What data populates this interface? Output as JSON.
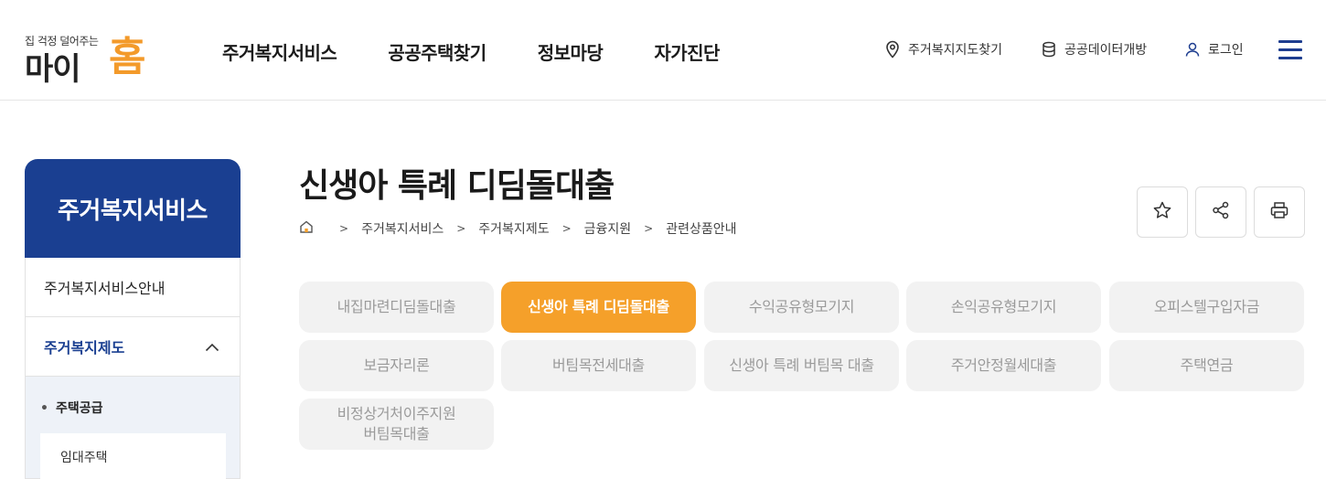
{
  "header": {
    "logo_tagline": "집 걱정 덜어주는",
    "logo_main": "마이",
    "logo_accent": "홈",
    "nav": [
      "주거복지서비스",
      "공공주택찾기",
      "정보마당",
      "자가진단"
    ],
    "util_map_label": "주거복지지도찾기",
    "util_data_label": "공공데이터개방",
    "util_login_label": "로그인",
    "accent_color": "#1a3f91"
  },
  "sidebar": {
    "title": "주거복지서비스",
    "items": [
      {
        "label": "주거복지서비스안내"
      },
      {
        "label": "주거복지제도"
      }
    ],
    "sub_item": "주택공급",
    "sub_sub_item": "임대주택"
  },
  "content": {
    "title": "신생아 특례 디딤돌대출",
    "breadcrumb": [
      "주거복지서비스",
      "주거복지제도",
      "금융지원",
      "관련상품안내"
    ],
    "tabs": [
      {
        "label": "내집마련디딤돌대출",
        "active": false
      },
      {
        "label": "신생아 특례 디딤돌대출",
        "active": true
      },
      {
        "label": "수익공유형모기지",
        "active": false
      },
      {
        "label": "손익공유형모기지",
        "active": false
      },
      {
        "label": "오피스텔구입자금",
        "active": false
      },
      {
        "label": "보금자리론",
        "active": false
      },
      {
        "label": "버팀목전세대출",
        "active": false
      },
      {
        "label": "신생아 특례 버팀목 대출",
        "active": false
      },
      {
        "label": "주거안정월세대출",
        "active": false
      },
      {
        "label": "주택연금",
        "active": false
      },
      {
        "label": "비정상거처이주지원\n버팀목대출",
        "active": false
      }
    ],
    "active_tab_color": "#f5a02a"
  },
  "icons": [
    "map-pin-icon",
    "database-icon",
    "user-icon",
    "hamburger-menu-icon",
    "home-icon",
    "star-icon",
    "share-icon",
    "print-icon",
    "chevron-up-icon"
  ]
}
